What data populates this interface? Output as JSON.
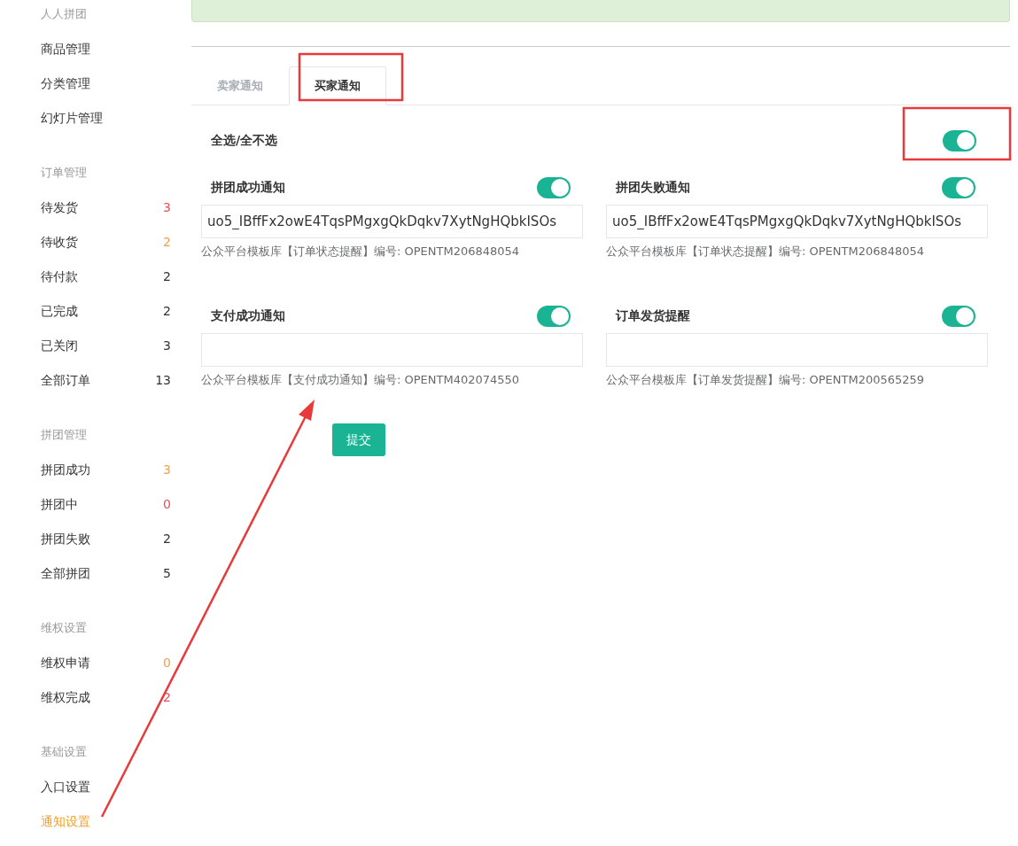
{
  "sidebar": {
    "sections": [
      {
        "title": "人人拼团",
        "items": [
          {
            "label": "商品管理",
            "selected": false
          },
          {
            "label": "分类管理",
            "selected": false
          },
          {
            "label": "幻灯片管理",
            "selected": false
          }
        ]
      },
      {
        "title": "订单管理",
        "items": [
          {
            "label": "待发货",
            "count": "3",
            "color": "#e4505a",
            "selected": false
          },
          {
            "label": "待收货",
            "count": "2",
            "color": "#f0a050",
            "selected": false
          },
          {
            "label": "待付款",
            "count": "2",
            "color": "#333333",
            "selected": false
          },
          {
            "label": "已完成",
            "count": "2",
            "color": "#333333",
            "selected": false
          },
          {
            "label": "已关闭",
            "count": "3",
            "color": "#333333",
            "selected": false
          },
          {
            "label": "全部订单",
            "count": "13",
            "color": "#333333",
            "selected": false
          }
        ]
      },
      {
        "title": "拼团管理",
        "items": [
          {
            "label": "拼团成功",
            "count": "3",
            "color": "#f0a050",
            "selected": false
          },
          {
            "label": "拼团中",
            "count": "0",
            "color": "#e4505a",
            "selected": false
          },
          {
            "label": "拼团失败",
            "count": "2",
            "color": "#333333",
            "selected": false
          },
          {
            "label": "全部拼团",
            "count": "5",
            "color": "#333333",
            "selected": false
          }
        ]
      },
      {
        "title": "维权设置",
        "items": [
          {
            "label": "维权申请",
            "count": "0",
            "color": "#f0a050",
            "selected": false
          },
          {
            "label": "维权完成",
            "count": "2",
            "color": "#e4505a",
            "selected": false
          }
        ]
      },
      {
        "title": "基础设置",
        "items": [
          {
            "label": "入口设置",
            "selected": false
          },
          {
            "label": "通知设置",
            "selected": true
          }
        ]
      }
    ]
  },
  "tabs": [
    {
      "label": "卖家通知",
      "selected": false
    },
    {
      "label": "买家通知",
      "selected": true
    }
  ],
  "select_all": {
    "label": "全选/全不选",
    "on": true
  },
  "notifications": [
    {
      "title": "拼团成功通知",
      "on": true,
      "value": "uo5_IBffFx2owE4TqsPMgxgQkDqkv7XytNgHQbkISOs",
      "hint": "公众平台模板库【订单状态提醒】编号: OPENTM206848054"
    },
    {
      "title": "拼团失败通知",
      "on": true,
      "value": "uo5_IBffFx2owE4TqsPMgxgQkDqkv7XytNgHQbkISOs",
      "hint": "公众平台模板库【订单状态提醒】编号: OPENTM206848054"
    },
    {
      "title": "支付成功通知",
      "on": true,
      "hint": "公众平台模板库【支付成功通知】编号: OPENTM402074550"
    },
    {
      "title": "订单发货提醒",
      "on": true,
      "hint": "公众平台模板库【订单发货提醒】编号: OPENTM200565259"
    }
  ],
  "submit_button": "提交"
}
